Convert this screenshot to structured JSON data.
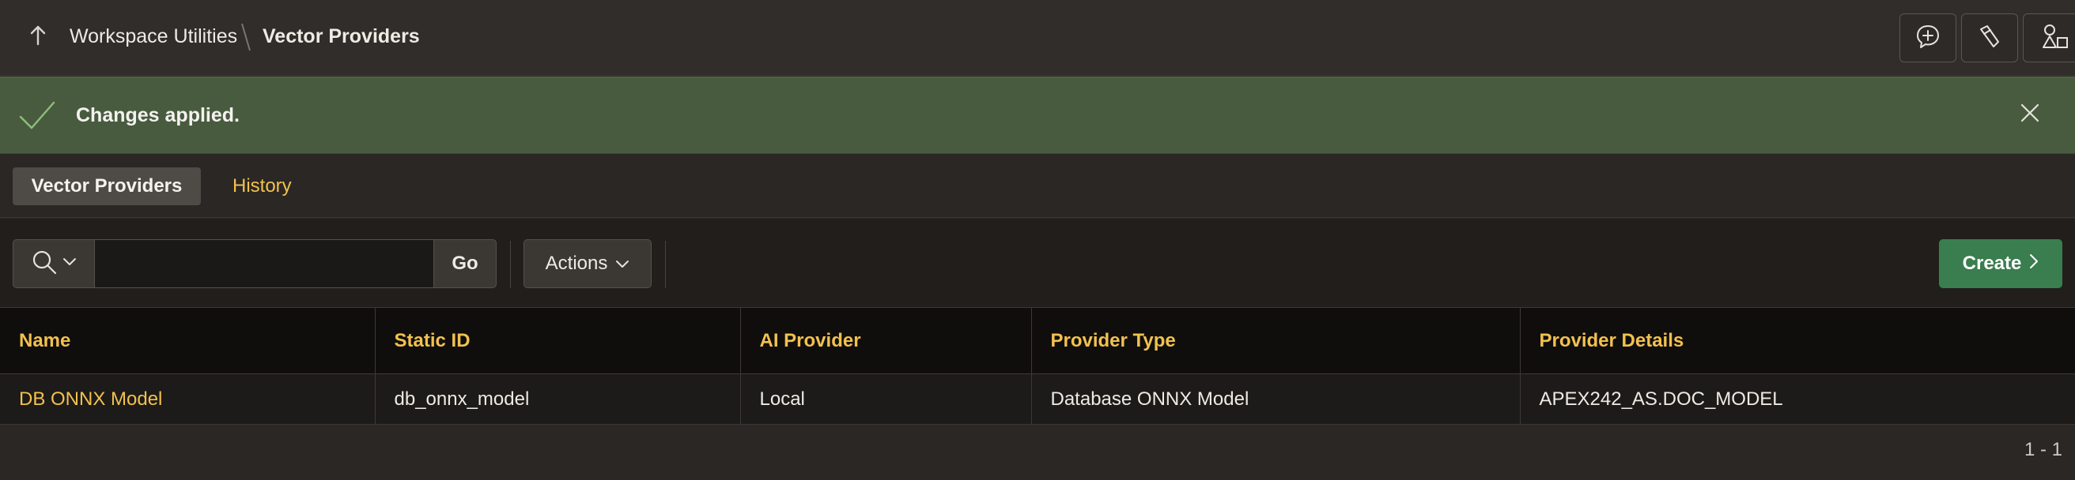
{
  "header": {
    "breadcrumb_parent": "Workspace Utilities",
    "breadcrumb_current": "Vector Providers",
    "buttons": [
      "comment-add-icon",
      "flashlight-icon",
      "shapes-icon"
    ]
  },
  "alert": {
    "message": "Changes applied.",
    "color": "#485b3f"
  },
  "tabs": [
    {
      "label": "Vector Providers",
      "active": true
    },
    {
      "label": "History",
      "active": false
    }
  ],
  "toolbar": {
    "search_value": "",
    "go_label": "Go",
    "actions_label": "Actions",
    "create_label": "Create",
    "create_color": "#3a7d4e"
  },
  "table": {
    "columns": [
      "Name",
      "Static ID",
      "AI Provider",
      "Provider Type",
      "Provider Details"
    ],
    "rows": [
      [
        "DB ONNX Model",
        "db_onnx_model",
        "Local",
        "Database ONNX Model",
        "APEX242_AS.DOC_MODEL"
      ]
    ]
  },
  "pagination": "1 - 1",
  "colors": {
    "accent": "#f2c14e",
    "background": "#2a2724"
  }
}
